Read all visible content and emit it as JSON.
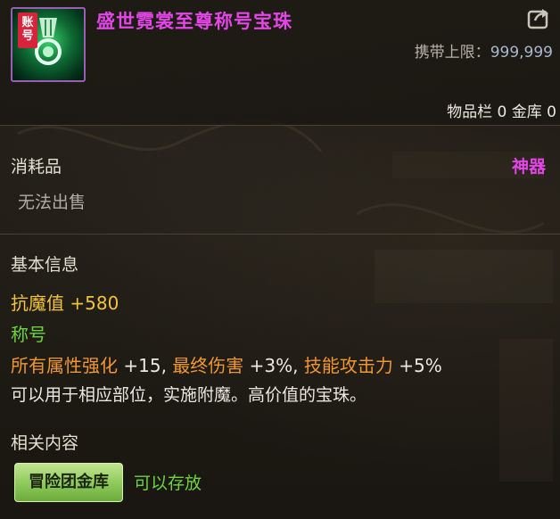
{
  "item": {
    "name": "盛世霓裳至尊称号宝珠",
    "account_tag": "账号",
    "carry_limit_label": "携带上限：",
    "carry_limit_value": "999,999",
    "storage_text": "物品栏 0 金库 0",
    "icon": "medal-icon"
  },
  "category": {
    "type": "消耗品",
    "rarity": "神器",
    "sell_status": "无法出售"
  },
  "basic_info": {
    "title": "基本信息",
    "magic_resist_label": "抗魔值",
    "magic_resist_value": "+580",
    "title_label": "称号",
    "stats": [
      {
        "label": "所有属性强化",
        "value": "+15"
      },
      {
        "label": "最终伤害",
        "value": "+3%"
      },
      {
        "label": "技能攻击力",
        "value": "+5%"
      }
    ],
    "description": "可以用于相应部位，实施附魔。高价值的宝珠。"
  },
  "related": {
    "title": "相关内容",
    "vault_button": "冒险团金库",
    "storable_text": "可以存放"
  },
  "colors": {
    "name": "#e246e6",
    "orange": "#ef9733",
    "yellow": "#f2c33a",
    "green": "#6ed23e"
  },
  "icons": {
    "share": "share-icon"
  }
}
